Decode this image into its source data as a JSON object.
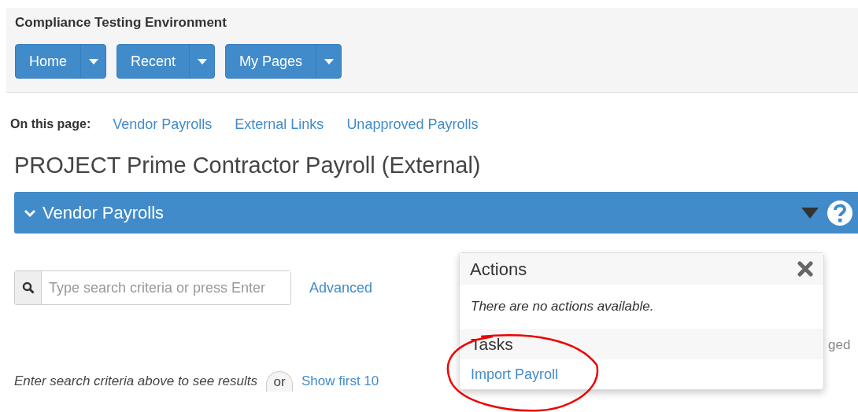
{
  "header": {
    "title": "Compliance Testing Environment",
    "nav_buttons": [
      {
        "label": "Home"
      },
      {
        "label": "Recent"
      },
      {
        "label": "My Pages"
      }
    ]
  },
  "on_this_page": {
    "label": "On this page:",
    "links": [
      "Vendor Payrolls",
      "External Links",
      "Unapproved Payrolls"
    ]
  },
  "page_title": "PROJECT Prime Contractor Payroll (External)",
  "section": {
    "title": "Vendor Payrolls",
    "expanded": true
  },
  "search": {
    "placeholder": "Type search criteria or press Enter",
    "advanced_link": "Advanced"
  },
  "results_hint": {
    "text": "Enter search criteria above to see results",
    "or": "or",
    "show_link": "Show first 10"
  },
  "background_text": "ged",
  "actions_popover": {
    "title": "Actions",
    "empty_text": "There are no actions available.",
    "tasks_heading": "Tasks",
    "tasks": [
      "Import Payroll"
    ]
  }
}
